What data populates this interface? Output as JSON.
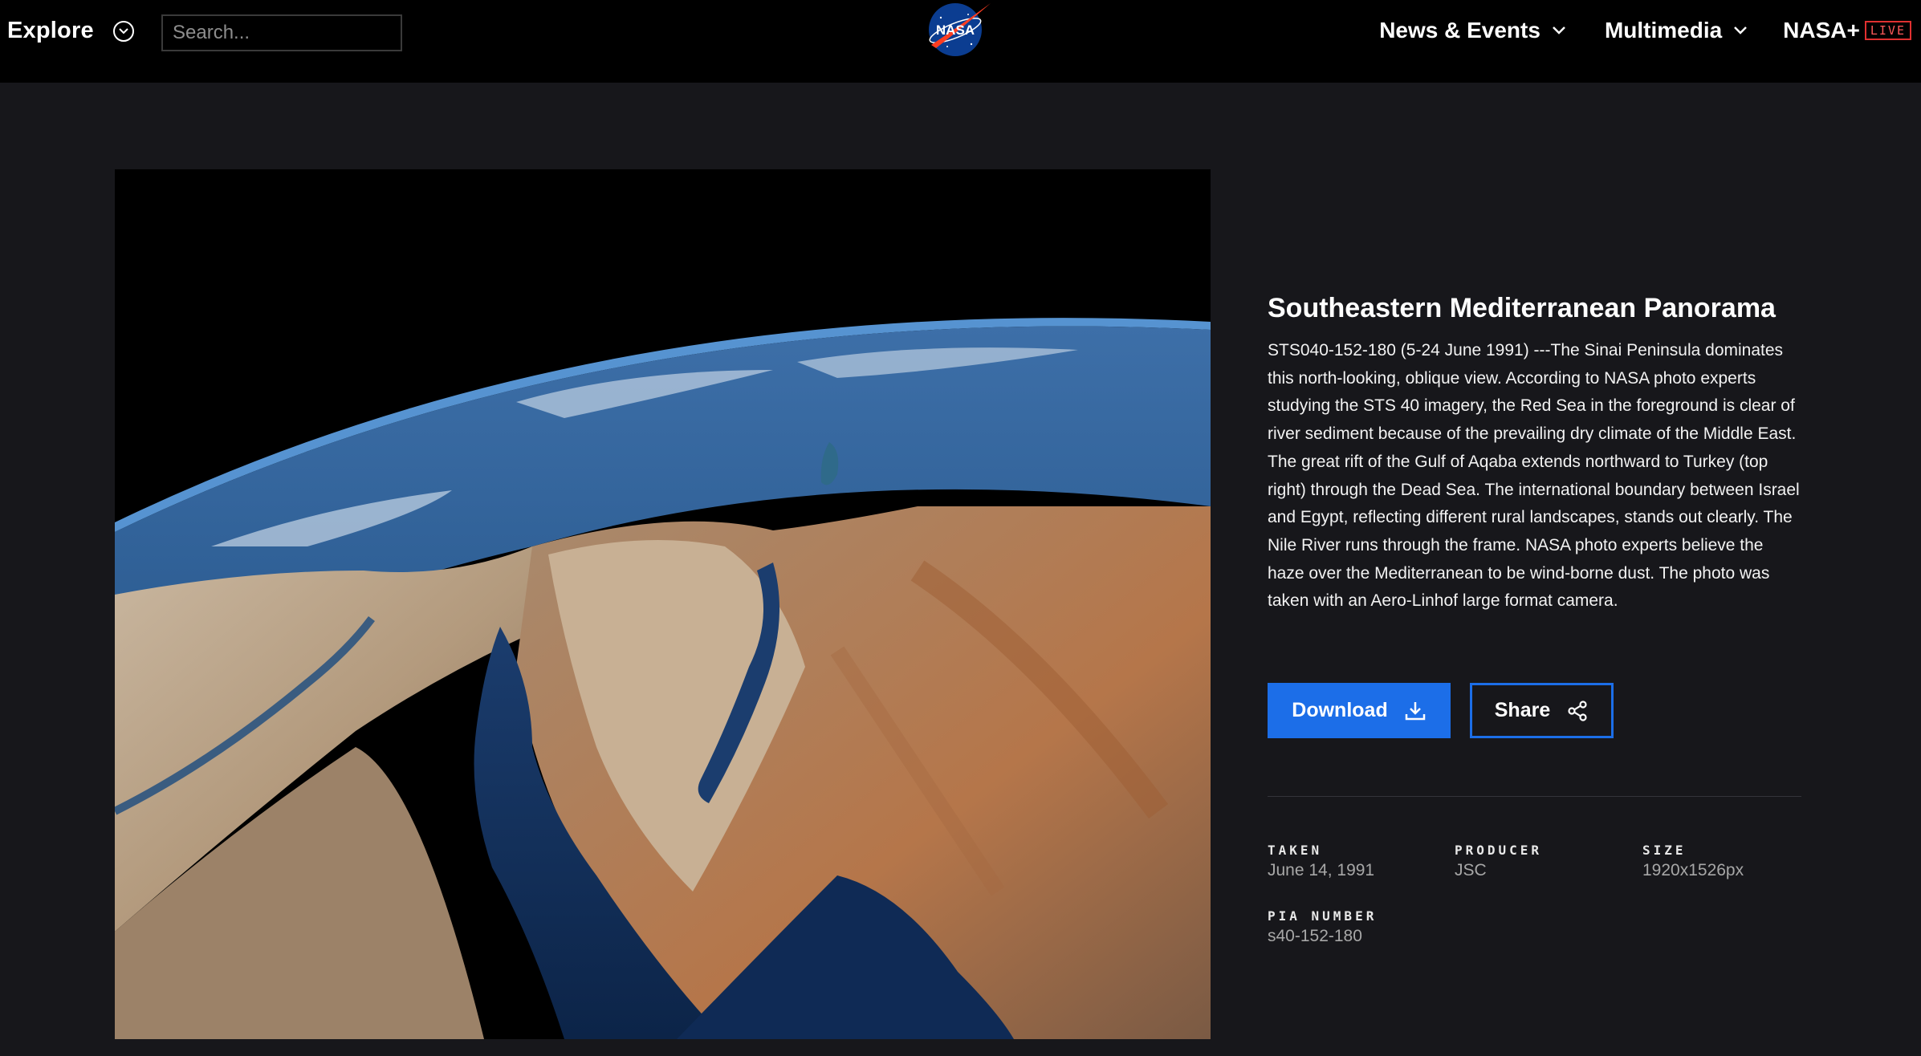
{
  "header": {
    "explore_label": "Explore",
    "search_placeholder": "Search...",
    "logo_text": "NASA",
    "nav": [
      {
        "label": "News & Events"
      },
      {
        "label": "Multimedia"
      }
    ],
    "nasa_plus_label": "NASA+",
    "live_badge": "LIVE"
  },
  "image": {
    "title": "Southeastern Mediterranean Panorama",
    "description": "STS040-152-180 (5-24 June 1991) ---The Sinai Peninsula dominates this north-looking, oblique view. According to NASA photo experts studying the STS 40 imagery, the Red Sea in the foreground is clear of river sediment because of the prevailing dry climate of the Middle East. The great rift of the Gulf of Aqaba extends northward to Turkey (top right) through the Dead Sea. The international boundary between Israel and Egypt, reflecting different rural landscapes, stands out clearly. The Nile River runs through the frame. NASA photo experts believe the haze over the Mediterranean to be wind-borne dust. The photo was taken with an Aero-Linhof large format camera."
  },
  "actions": {
    "download_label": "Download",
    "share_label": "Share"
  },
  "metadata": {
    "taken_label": "TAKEN",
    "taken_value": "June 14, 1991",
    "producer_label": "PRODUCER",
    "producer_value": "JSC",
    "size_label": "SIZE",
    "size_value": "1920x1526px",
    "pia_label": "PIA NUMBER",
    "pia_value": "s40-152-180"
  },
  "colors": {
    "accent": "#1c6ee8",
    "live": "#e03030",
    "background": "#17171b",
    "header": "#000000"
  }
}
